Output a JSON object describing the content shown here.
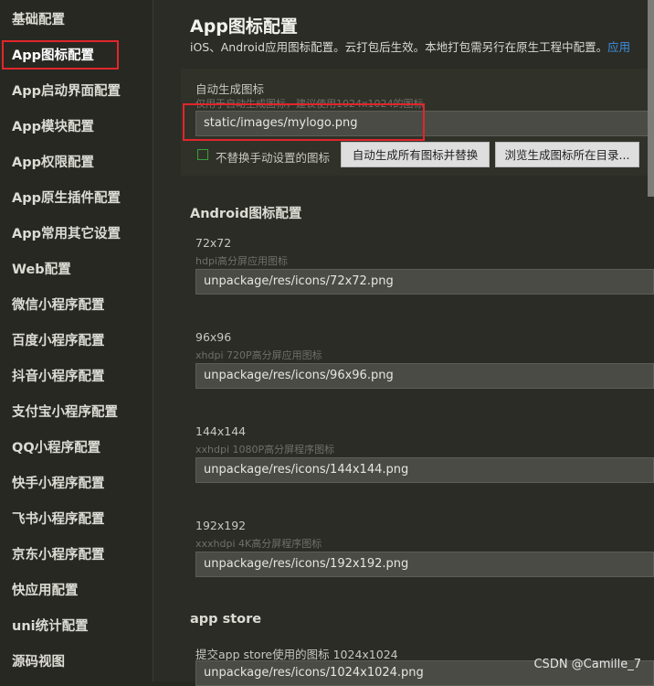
{
  "sidebar": {
    "items": [
      {
        "label": "基础配置"
      },
      {
        "label": "App图标配置"
      },
      {
        "label": "App启动界面配置"
      },
      {
        "label": "App模块配置"
      },
      {
        "label": "App权限配置"
      },
      {
        "label": "App原生插件配置"
      },
      {
        "label": "App常用其它设置"
      },
      {
        "label": "Web配置"
      },
      {
        "label": "微信小程序配置"
      },
      {
        "label": "百度小程序配置"
      },
      {
        "label": "抖音小程序配置"
      },
      {
        "label": "支付宝小程序配置"
      },
      {
        "label": "QQ小程序配置"
      },
      {
        "label": "快手小程序配置"
      },
      {
        "label": "飞书小程序配置"
      },
      {
        "label": "京东小程序配置"
      },
      {
        "label": "快应用配置"
      },
      {
        "label": "uni统计配置"
      },
      {
        "label": "源码视图"
      }
    ],
    "active_index": 1
  },
  "main": {
    "title": "App图标配置",
    "description": "iOS、Android应用图标配置。云打包后生效。本地打包需另行在原生工程中配置。",
    "description_link": "应用",
    "auto": {
      "label": "自动生成图标",
      "hint": "仅用于自动生成图标，建议使用1024x1024的图标",
      "path": "static/images/mylogo.png",
      "checkbox_label": "不替换手动设置的图标",
      "checkbox_checked": false,
      "generate_button": "自动生成所有图标并替换",
      "browse_button": "浏览生成图标所在目录..."
    },
    "android": {
      "title": "Android图标配置",
      "icons": [
        {
          "size": "72x72",
          "hint": "hdpi高分屏应用图标",
          "path": "unpackage/res/icons/72x72.png"
        },
        {
          "size": "96x96",
          "hint": "xhdpi 720P高分屏应用图标",
          "path": "unpackage/res/icons/96x96.png"
        },
        {
          "size": "144x144",
          "hint": "xxhdpi 1080P高分屏程序图标",
          "path": "unpackage/res/icons/144x144.png"
        },
        {
          "size": "192x192",
          "hint": "xxxhdpi 4K高分屏程序图标",
          "path": "unpackage/res/icons/192x192.png"
        }
      ]
    },
    "appstore": {
      "title": "app store",
      "label": "提交app store使用的图标 1024x1024",
      "path": "unpackage/res/icons/1024x1024.png"
    }
  },
  "watermark": "CSDN @Camille_7",
  "colors": {
    "highlight_border": "#e0262b",
    "checkbox_border": "#35a13a",
    "link": "#3d8fe0"
  }
}
